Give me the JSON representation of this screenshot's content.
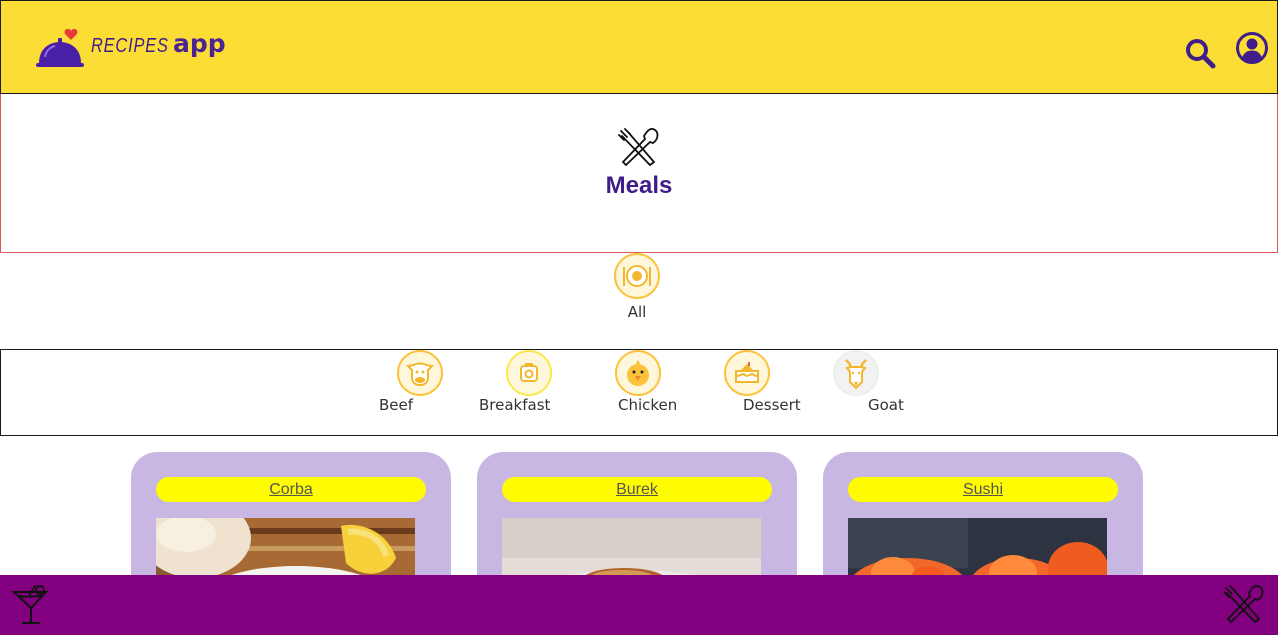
{
  "header": {
    "logo_text_1": "RECIPES",
    "logo_text_2": "app"
  },
  "page": {
    "title": "Meals"
  },
  "filters": {
    "all_label": "All",
    "categories": [
      {
        "label": "Beef",
        "icon": "cow-icon"
      },
      {
        "label": "Breakfast",
        "icon": "toaster-icon"
      },
      {
        "label": "Chicken",
        "icon": "chick-icon"
      },
      {
        "label": "Dessert",
        "icon": "cake-icon"
      },
      {
        "label": "Goat",
        "icon": "goat-icon"
      }
    ]
  },
  "meals": [
    {
      "name": "Corba"
    },
    {
      "name": "Burek"
    },
    {
      "name": "Sushi"
    }
  ],
  "colors": {
    "header_bg": "#fcdd36",
    "brand_purple": "#3f1e8a",
    "footer_bg": "#82007f",
    "card_bg": "#c8b7e2",
    "card_name_bg": "#fffb00",
    "category_accent": "#fbc23a"
  }
}
